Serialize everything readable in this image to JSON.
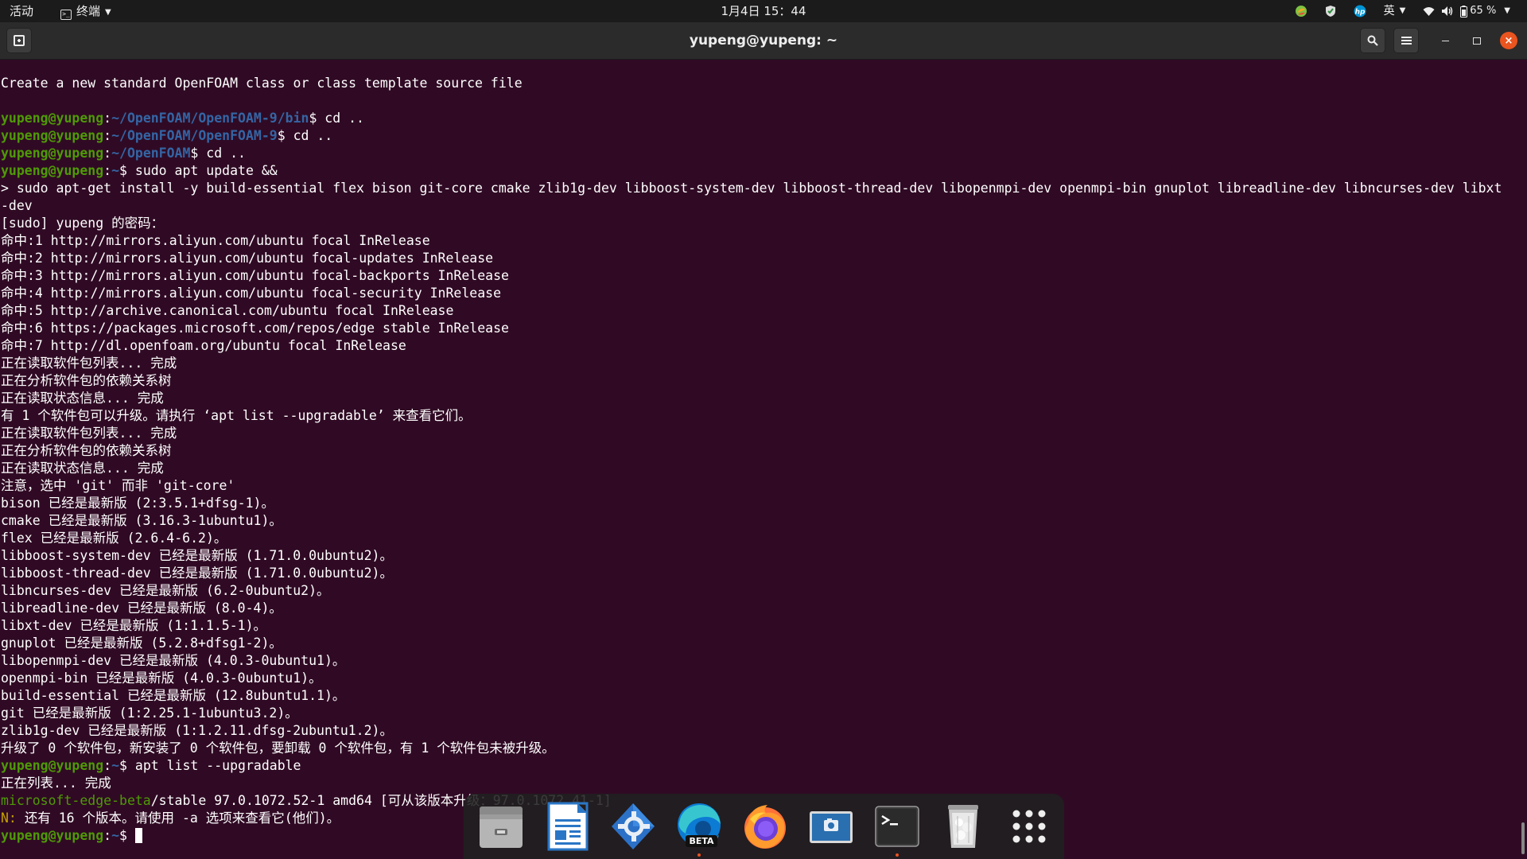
{
  "topbar": {
    "activities": "活动",
    "app_menu": "终端",
    "clock": "1月4日 15：44",
    "input_method": "英",
    "battery": "65 %"
  },
  "window": {
    "title": "yupeng@yupeng: ~"
  },
  "terminal": {
    "lines": [
      [
        {
          "t": "Create a new standard OpenFOAM class or class template source file",
          "c": ""
        }
      ],
      [
        {
          "t": "",
          "c": ""
        }
      ],
      [
        {
          "t": "yupeng@yupeng",
          "c": "u"
        },
        {
          "t": ":",
          "c": ""
        },
        {
          "t": "~/OpenFOAM/OpenFOAM-9/bin",
          "c": "p"
        },
        {
          "t": "$ cd ..",
          "c": ""
        }
      ],
      [
        {
          "t": "yupeng@yupeng",
          "c": "u"
        },
        {
          "t": ":",
          "c": ""
        },
        {
          "t": "~/OpenFOAM/OpenFOAM-9",
          "c": "p"
        },
        {
          "t": "$ cd ..",
          "c": ""
        }
      ],
      [
        {
          "t": "yupeng@yupeng",
          "c": "u"
        },
        {
          "t": ":",
          "c": ""
        },
        {
          "t": "~/OpenFOAM",
          "c": "p"
        },
        {
          "t": "$ cd ..",
          "c": ""
        }
      ],
      [
        {
          "t": "yupeng@yupeng",
          "c": "u"
        },
        {
          "t": ":",
          "c": ""
        },
        {
          "t": "~",
          "c": "p"
        },
        {
          "t": "$ sudo apt update &&",
          "c": ""
        }
      ],
      [
        {
          "t": "> sudo apt-get install -y build-essential flex bison git-core cmake zlib1g-dev libboost-system-dev libboost-thread-dev libopenmpi-dev openmpi-bin gnuplot libreadline-dev libncurses-dev libxt",
          "c": ""
        }
      ],
      [
        {
          "t": "-dev",
          "c": ""
        }
      ],
      [
        {
          "t": "[sudo] yupeng 的密码：",
          "c": ""
        }
      ],
      [
        {
          "t": "命中:1 http://mirrors.aliyun.com/ubuntu focal InRelease",
          "c": ""
        }
      ],
      [
        {
          "t": "命中:2 http://mirrors.aliyun.com/ubuntu focal-updates InRelease",
          "c": ""
        }
      ],
      [
        {
          "t": "命中:3 http://mirrors.aliyun.com/ubuntu focal-backports InRelease",
          "c": ""
        }
      ],
      [
        {
          "t": "命中:4 http://mirrors.aliyun.com/ubuntu focal-security InRelease",
          "c": ""
        }
      ],
      [
        {
          "t": "命中:5 http://archive.canonical.com/ubuntu focal InRelease",
          "c": ""
        }
      ],
      [
        {
          "t": "命中:6 https://packages.microsoft.com/repos/edge stable InRelease",
          "c": ""
        }
      ],
      [
        {
          "t": "命中:7 http://dl.openfoam.org/ubuntu focal InRelease",
          "c": ""
        }
      ],
      [
        {
          "t": "正在读取软件包列表... 完成",
          "c": ""
        }
      ],
      [
        {
          "t": "正在分析软件包的依赖关系树",
          "c": ""
        }
      ],
      [
        {
          "t": "正在读取状态信息... 完成",
          "c": ""
        }
      ],
      [
        {
          "t": "有 1 个软件包可以升级。请执行 ‘apt list --upgradable’ 来查看它们。",
          "c": ""
        }
      ],
      [
        {
          "t": "正在读取软件包列表... 完成",
          "c": ""
        }
      ],
      [
        {
          "t": "正在分析软件包的依赖关系树",
          "c": ""
        }
      ],
      [
        {
          "t": "正在读取状态信息... 完成",
          "c": ""
        }
      ],
      [
        {
          "t": "注意，选中 'git' 而非 'git-core'",
          "c": ""
        }
      ],
      [
        {
          "t": "bison 已经是最新版 (2:3.5.1+dfsg-1)。",
          "c": ""
        }
      ],
      [
        {
          "t": "cmake 已经是最新版 (3.16.3-1ubuntu1)。",
          "c": ""
        }
      ],
      [
        {
          "t": "flex 已经是最新版 (2.6.4-6.2)。",
          "c": ""
        }
      ],
      [
        {
          "t": "libboost-system-dev 已经是最新版 (1.71.0.0ubuntu2)。",
          "c": ""
        }
      ],
      [
        {
          "t": "libboost-thread-dev 已经是最新版 (1.71.0.0ubuntu2)。",
          "c": ""
        }
      ],
      [
        {
          "t": "libncurses-dev 已经是最新版 (6.2-0ubuntu2)。",
          "c": ""
        }
      ],
      [
        {
          "t": "libreadline-dev 已经是最新版 (8.0-4)。",
          "c": ""
        }
      ],
      [
        {
          "t": "libxt-dev 已经是最新版 (1:1.1.5-1)。",
          "c": ""
        }
      ],
      [
        {
          "t": "gnuplot 已经是最新版 (5.2.8+dfsg1-2)。",
          "c": ""
        }
      ],
      [
        {
          "t": "libopenmpi-dev 已经是最新版 (4.0.3-0ubuntu1)。",
          "c": ""
        }
      ],
      [
        {
          "t": "openmpi-bin 已经是最新版 (4.0.3-0ubuntu1)。",
          "c": ""
        }
      ],
      [
        {
          "t": "build-essential 已经是最新版 (12.8ubuntu1.1)。",
          "c": ""
        }
      ],
      [
        {
          "t": "git 已经是最新版 (1:2.25.1-1ubuntu3.2)。",
          "c": ""
        }
      ],
      [
        {
          "t": "zlib1g-dev 已经是最新版 (1:1.2.11.dfsg-2ubuntu1.2)。",
          "c": ""
        }
      ],
      [
        {
          "t": "升级了 0 个软件包，新安装了 0 个软件包，要卸载 0 个软件包，有 1 个软件包未被升级。",
          "c": ""
        }
      ],
      [
        {
          "t": "yupeng@yupeng",
          "c": "u"
        },
        {
          "t": ":",
          "c": ""
        },
        {
          "t": "~",
          "c": "p"
        },
        {
          "t": "$ apt list --upgradable",
          "c": ""
        }
      ],
      [
        {
          "t": "正在列表... 完成",
          "c": ""
        }
      ],
      [
        {
          "t": "microsoft-edge-beta",
          "c": "g"
        },
        {
          "t": "/stable 97.0.1072.52-1 amd64 [可从该版本升级：97.0.1072.41-1]",
          "c": ""
        }
      ],
      [
        {
          "t": "N: ",
          "c": "y"
        },
        {
          "t": "还有 16 个版本。请使用 -a 选项来查看它(他们)。",
          "c": ""
        }
      ],
      [
        {
          "t": "yupeng@yupeng",
          "c": "u"
        },
        {
          "t": ":",
          "c": ""
        },
        {
          "t": "~",
          "c": "p"
        },
        {
          "t": "$ ",
          "c": ""
        },
        {
          "cursor": true
        }
      ]
    ]
  },
  "dock": {
    "items": [
      {
        "name": "files-icon",
        "running": false
      },
      {
        "name": "writer-icon",
        "running": false
      },
      {
        "name": "software-icon",
        "running": false
      },
      {
        "name": "edge-beta-icon",
        "running": true,
        "badge": "BETA"
      },
      {
        "name": "firefox-icon",
        "running": false
      },
      {
        "name": "screenshot-icon",
        "running": false
      },
      {
        "name": "terminal-icon",
        "running": true
      },
      {
        "name": "trash-icon",
        "running": false
      },
      {
        "name": "show-apps-icon",
        "running": false
      }
    ]
  },
  "colors": {
    "terminal_bg": "#300a24",
    "prompt_user": "#4e9a06",
    "prompt_path": "#3465a4",
    "close_button": "#e9541f"
  }
}
